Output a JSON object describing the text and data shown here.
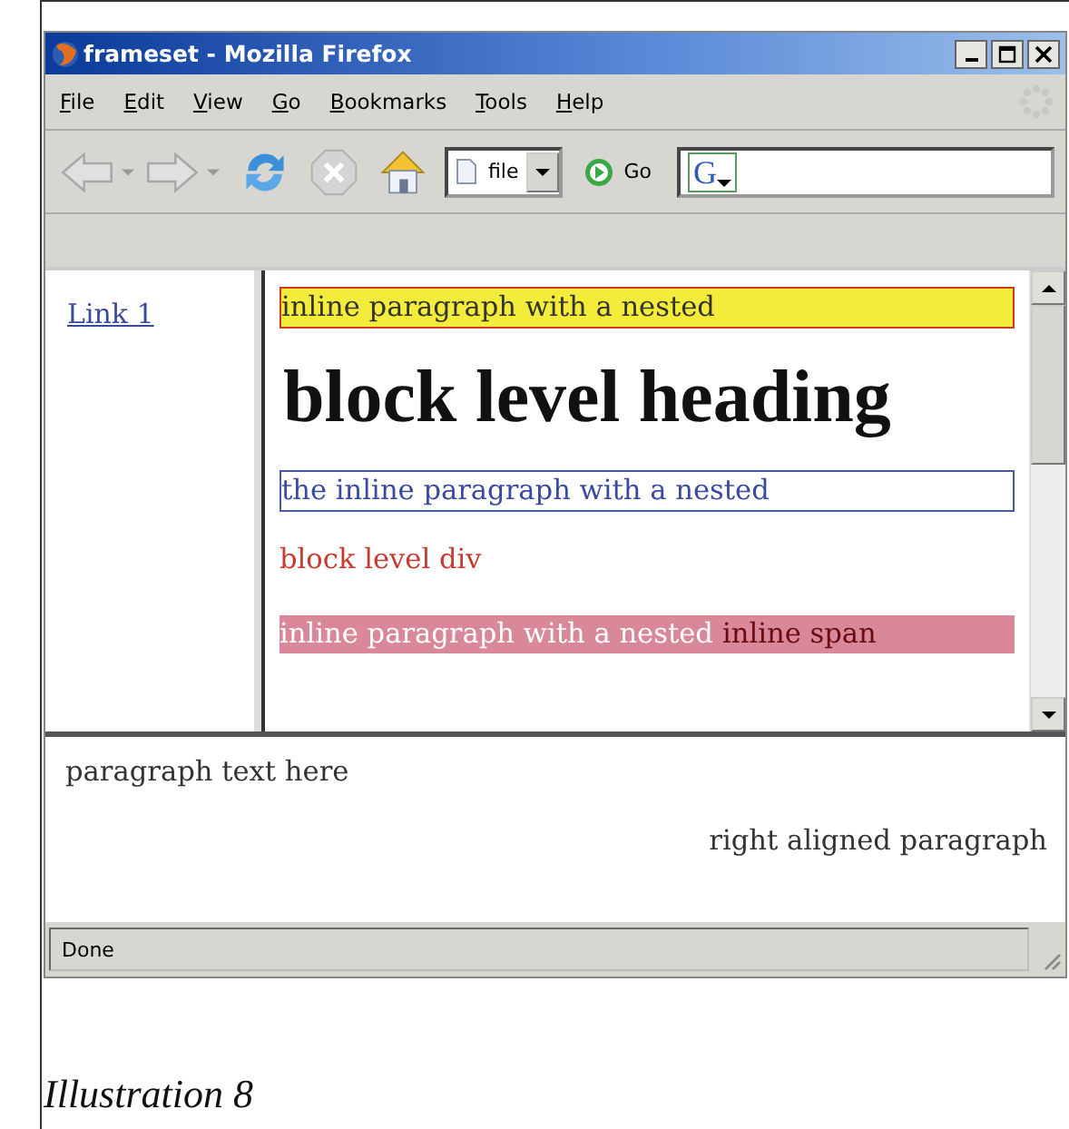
{
  "window": {
    "title": "frameset - Mozilla Firefox"
  },
  "menu": [
    "File",
    "Edit",
    "View",
    "Go",
    "Bookmarks",
    "Tools",
    "Help"
  ],
  "toolbar": {
    "address": "file",
    "go": "Go",
    "search_engine": "G"
  },
  "left_frame": {
    "links": [
      "Link 1"
    ]
  },
  "main_frame": {
    "blocks": [
      {
        "kind": "yellow_box",
        "text": "inline paragraph with a nested"
      },
      {
        "kind": "heading",
        "text": "block level heading"
      },
      {
        "kind": "blue_box",
        "text": "the inline paragraph with a nested"
      },
      {
        "kind": "red_div",
        "text": "block level div"
      },
      {
        "kind": "pink_bar",
        "text": "inline paragraph with a nested",
        "span": "inline span"
      }
    ]
  },
  "bottom_frame": {
    "paragraphs": [
      {
        "text": "paragraph text here",
        "right_aligned": false
      },
      {
        "text": "right aligned paragraph",
        "right_aligned": true
      }
    ]
  },
  "status_bar": {
    "text": "Done"
  },
  "caption": "Illustration 8"
}
